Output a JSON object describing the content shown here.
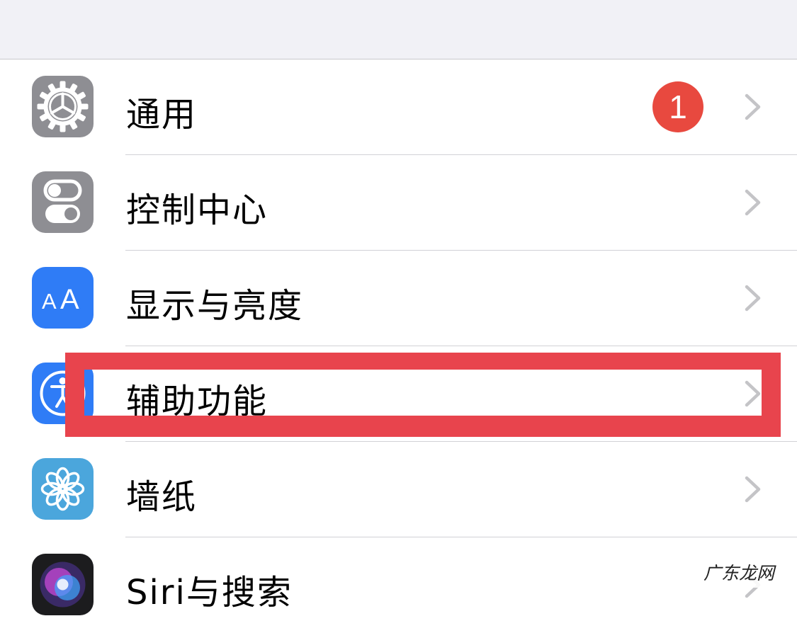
{
  "settings_list": {
    "items": [
      {
        "label": "通用",
        "icon": "gear-icon",
        "icon_color": "#8e8e93",
        "badge": "1"
      },
      {
        "label": "控制中心",
        "icon": "toggles-icon",
        "icon_color": "#8e8e93"
      },
      {
        "label": "显示与亮度",
        "icon": "text-size-icon",
        "icon_color": "#2f7cf6"
      },
      {
        "label": "辅助功能",
        "icon": "accessibility-icon",
        "icon_color": "#2f7cf6",
        "highlighted": true
      },
      {
        "label": "墙纸",
        "icon": "flower-icon",
        "icon_color": "#4ba6dc"
      },
      {
        "label": "Siri与搜索",
        "icon": "siri-icon",
        "icon_color": "#1c1c1e"
      }
    ]
  },
  "annotation": {
    "highlight_color": "#e8444d"
  },
  "watermark": {
    "text": "广东龙网"
  },
  "colors": {
    "badge": "#e8493f",
    "chevron": "#c4c4c7",
    "header_bg": "#f1f1f6",
    "separator": "#d1d1d6"
  }
}
